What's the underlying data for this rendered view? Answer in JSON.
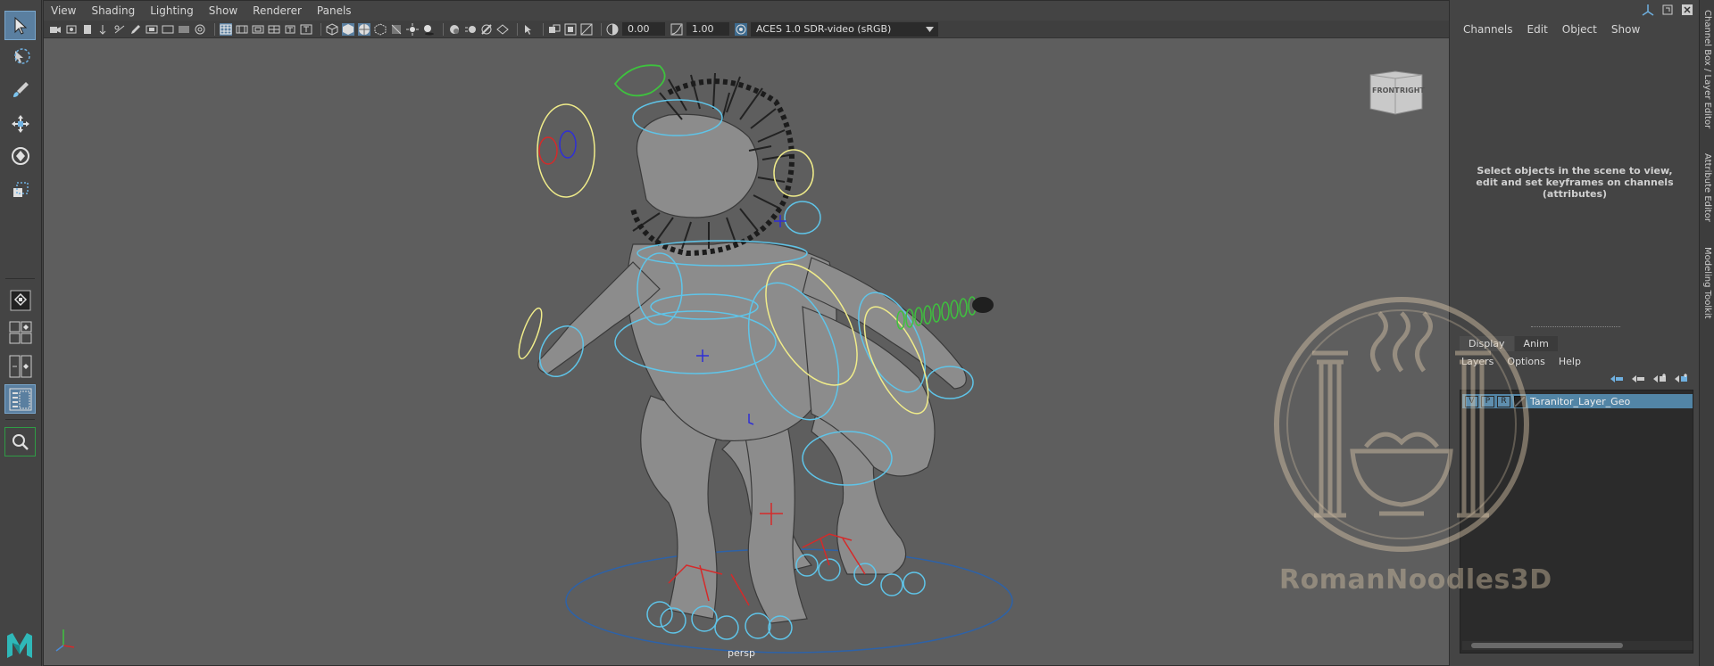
{
  "viewport": {
    "menu": [
      "View",
      "Shading",
      "Lighting",
      "Show",
      "Renderer",
      "Panels"
    ],
    "exposure_value": "0.00",
    "gamma_value": "1.00",
    "color_space": "ACES 1.0 SDR-video (sRGB)",
    "camera_label": "persp",
    "viewcube": {
      "front": "FRONT",
      "right": "RIGHT"
    }
  },
  "channel_box": {
    "menu": [
      "Channels",
      "Edit",
      "Object",
      "Show"
    ],
    "message": "Select objects in the scene to view, edit and set keyframes on channels (attributes)"
  },
  "layer_editor": {
    "tabs": [
      "Display",
      "Anim"
    ],
    "active_tab": "Display",
    "menu": [
      "Layers",
      "Options",
      "Help"
    ],
    "layer": {
      "v": "V",
      "p": "P",
      "r": "R",
      "name": "Taranitor_Layer_Geo"
    }
  },
  "side_tabs": [
    "Channel Box / Layer Editor",
    "Attribute Editor",
    "Modeling Toolkit"
  ],
  "watermark": {
    "text": "RomanNoodles3D"
  },
  "colors": {
    "accent": "#5285a6",
    "viewport_bg": "#5e5e5e",
    "panel_bg": "#444444"
  }
}
